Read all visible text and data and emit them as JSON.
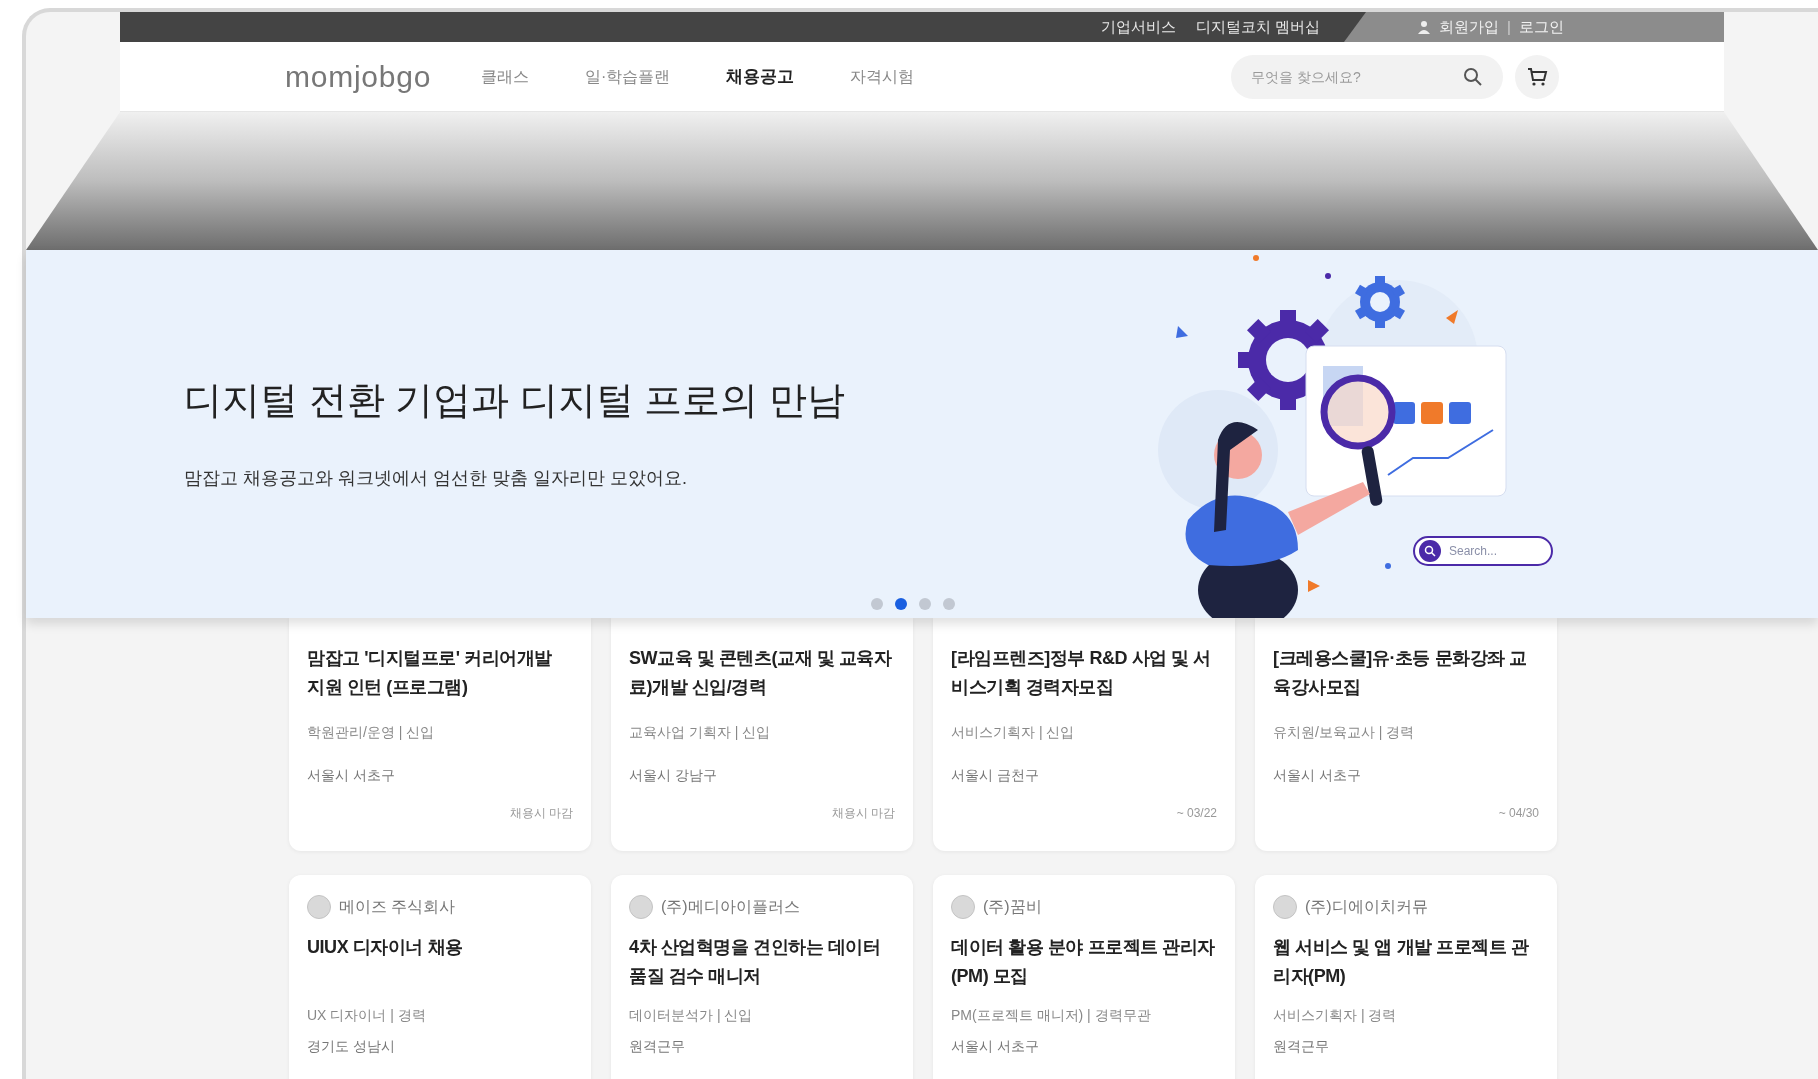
{
  "top_bar": {
    "links": [
      "기업서비스",
      "디지털코치 멤버십"
    ],
    "account": [
      "회원가입",
      "로그인"
    ],
    "separator": "|"
  },
  "nav": {
    "logo": "momjobgo",
    "items": [
      {
        "label": "클래스",
        "selected": false
      },
      {
        "label": "일·학습플랜",
        "selected": false
      },
      {
        "label": "채용공고",
        "selected": true
      },
      {
        "label": "자격시험",
        "selected": false
      }
    ],
    "search": {
      "placeholder": "무엇을 찾으세요?"
    }
  },
  "banner": {
    "title": "디지털 전환 기업과 디지털 프로의 만남",
    "subtitle": "맘잡고 채용공고와 워크넷에서 엄선한 맞춤 일자리만 모았어요.",
    "illustration_search": "Search...",
    "dots": [
      {
        "selected": false
      },
      {
        "selected": true
      },
      {
        "selected": false
      },
      {
        "selected": false
      }
    ]
  },
  "jobs_row_1": [
    {
      "title": "맘잡고 '디지털프로' 커리어개발 지원 인턴 (프로그램)",
      "meta": "학원관리/운영 | 신입",
      "location": "서울시 서초구",
      "deadline": "채용시 마감"
    },
    {
      "title": "SW교육 및 콘텐츠(교재 및 교육자료)개발 신입/경력",
      "meta": "교육사업 기획자 | 신입",
      "location": "서울시 강남구",
      "deadline": "채용시 마감"
    },
    {
      "title": "[라임프렌즈]정부 R&D 사업 및 서비스기획 경력자모집",
      "meta": "서비스기획자 | 신입",
      "location": "서울시 금천구",
      "deadline": "~ 03/22"
    },
    {
      "title": "[크레용스쿨]유·초등 문화강좌 교육강사모집",
      "meta": "유치원/보육교사 | 경력",
      "location": "서울시 서초구",
      "deadline": "~ 04/30"
    }
  ],
  "jobs_row_2": [
    {
      "company": "메이즈 주식회사",
      "title": "UIUX 디자이너 채용",
      "meta": "UX 디자이너 | 경력",
      "location": "경기도 성남시"
    },
    {
      "company": "(주)메디아이플러스",
      "title": "4차 산업혁명을 견인하는 데이터 품질 검수 매니저",
      "meta": "데이터분석가 | 신입",
      "location": "원격근무"
    },
    {
      "company": "(주)꿈비",
      "title": "데이터 활용 분야 프로젝트 관리자(PM) 모집",
      "meta": "PM(프로젝트 매니저) | 경력무관",
      "location": "서울시 서초구"
    },
    {
      "company": "(주)디에이치커뮤",
      "title": "웹 서비스 및 앱 개발 프로젝트 관리자(PM)",
      "meta": "서비스기획자 | 경력",
      "location": "원격근무"
    }
  ]
}
